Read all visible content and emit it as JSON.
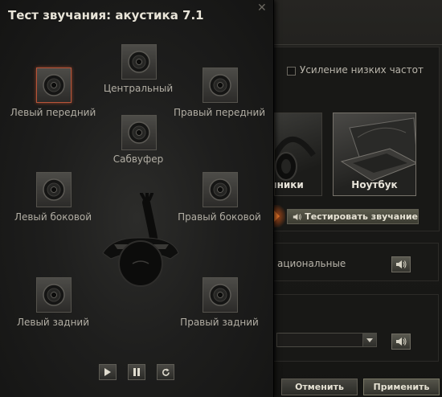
{
  "dialog": {
    "title": "Тест звучания: акустика 7.1",
    "close_icon": "close-icon",
    "speakers": {
      "center": "Центральный",
      "front_left": "Левый передний",
      "front_right": "Правый передний",
      "subwoofer": "Сабвуфер",
      "side_left": "Левый боковой",
      "side_right": "Правый боковой",
      "rear_left": "Левый задний",
      "rear_right": "Правый задний"
    },
    "selected_speaker": "front_left",
    "controls": {
      "play_icon": "play-icon",
      "pause_icon": "pause-icon",
      "repeat_icon": "repeat-icon"
    }
  },
  "settings": {
    "bass_boost_label": "Усиление низких частот",
    "bass_boost_checked": false,
    "devices": {
      "headphones_label": "ушники",
      "laptop_label": "Ноутбук"
    },
    "test_sound_button": "Тестировать звучание",
    "row_label": "ациональные"
  },
  "footer": {
    "cancel": "Отменить",
    "apply": "Применить"
  },
  "colors": {
    "accent_selected": "#b9553a",
    "arrow_glow": "#e8762a",
    "text": "#b2aea4"
  }
}
